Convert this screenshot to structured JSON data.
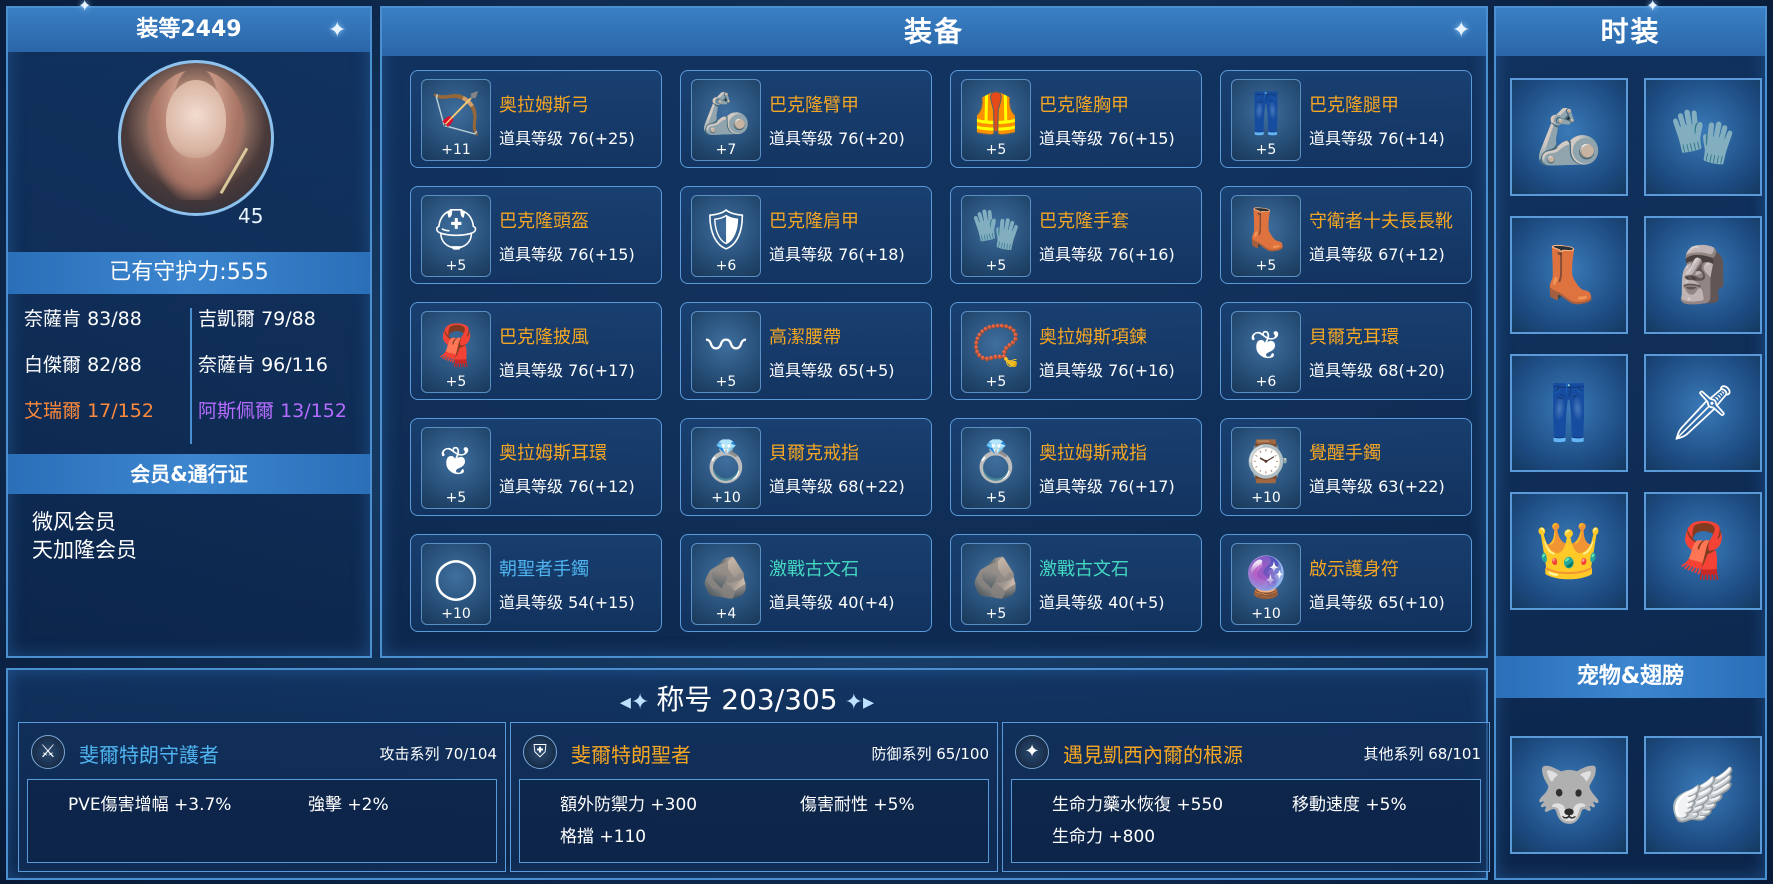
{
  "colors": {
    "panel_border": "#4a8fd0",
    "header_bg": "#3a7fc4",
    "orange_name": "#f5a623",
    "blue_name": "#4fb4f0",
    "teal_name": "#44d8c0",
    "stat_orange": "#ff8a3c",
    "stat_purple": "#b46cff",
    "title_orange": "#f5a623",
    "title_blue": "#4fb4f0"
  },
  "character": {
    "item_level_label": "装等2449",
    "level": "45",
    "guard_power": "已有守护力:555",
    "stats": [
      {
        "name": "奈薩肯",
        "value": "83/88",
        "color": "#ffffff"
      },
      {
        "name": "吉凱爾",
        "value": "79/88",
        "color": "#ffffff"
      },
      {
        "name": "白傑爾",
        "value": "82/88",
        "color": "#ffffff"
      },
      {
        "name": "奈薩肯",
        "value": "96/116",
        "color": "#ffffff"
      },
      {
        "name": "艾瑞爾",
        "value": "17/152",
        "color": "#ff8a3c"
      },
      {
        "name": "阿斯佩爾",
        "value": "13/152",
        "color": "#b46cff"
      }
    ],
    "vip_header": "会员&通行证",
    "vip_lines": [
      "微风会员",
      "天加隆会员"
    ]
  },
  "equipment": {
    "header": "装备",
    "items": [
      {
        "name": "奥拉姆斯弓",
        "level": "道具等级 76(+25)",
        "plus": "+11",
        "color": "#f5a623",
        "icon": "bow-icon",
        "glyph": "🏹"
      },
      {
        "name": "巴克隆臂甲",
        "level": "道具等级 76(+20)",
        "plus": "+7",
        "color": "#f5a623",
        "icon": "bracer-icon",
        "glyph": "🦾"
      },
      {
        "name": "巴克隆胸甲",
        "level": "道具等级 76(+15)",
        "plus": "+5",
        "color": "#f5a623",
        "icon": "chest-armor-icon",
        "glyph": "🦺"
      },
      {
        "name": "巴克隆腿甲",
        "level": "道具等级 76(+14)",
        "plus": "+5",
        "color": "#f5a623",
        "icon": "leg-armor-icon",
        "glyph": "👖"
      },
      {
        "name": "巴克隆頭盔",
        "level": "道具等级 76(+15)",
        "plus": "+5",
        "color": "#f5a623",
        "icon": "helmet-icon",
        "glyph": "⛑"
      },
      {
        "name": "巴克隆肩甲",
        "level": "道具等级 76(+18)",
        "plus": "+6",
        "color": "#f5a623",
        "icon": "shoulder-armor-icon",
        "glyph": "🛡"
      },
      {
        "name": "巴克隆手套",
        "level": "道具等级 76(+16)",
        "plus": "+5",
        "color": "#f5a623",
        "icon": "gloves-icon",
        "glyph": "🧤"
      },
      {
        "name": "守衛者十夫長長靴",
        "level": "道具等级 67(+12)",
        "plus": "+5",
        "color": "#f5a623",
        "icon": "boots-icon",
        "glyph": "👢"
      },
      {
        "name": "巴克隆披風",
        "level": "道具等级 76(+17)",
        "plus": "+5",
        "color": "#f5a623",
        "icon": "cape-icon",
        "glyph": "🧣"
      },
      {
        "name": "高潔腰帶",
        "level": "道具等级 65(+5)",
        "plus": "+5",
        "color": "#f5a623",
        "icon": "belt-icon",
        "glyph": "〰"
      },
      {
        "name": "奥拉姆斯項鍊",
        "level": "道具等级 76(+16)",
        "plus": "+5",
        "color": "#f5a623",
        "icon": "necklace-icon",
        "glyph": "📿"
      },
      {
        "name": "貝爾克耳環",
        "level": "道具等级 68(+20)",
        "plus": "+6",
        "color": "#f5a623",
        "icon": "earring-icon",
        "glyph": "❦"
      },
      {
        "name": "奥拉姆斯耳環",
        "level": "道具等级 76(+12)",
        "plus": "+5",
        "color": "#f5a623",
        "icon": "earring-icon",
        "glyph": "❦"
      },
      {
        "name": "貝爾克戒指",
        "level": "道具等级 68(+22)",
        "plus": "+10",
        "color": "#f5a623",
        "icon": "ring-icon",
        "glyph": "💍"
      },
      {
        "name": "奥拉姆斯戒指",
        "level": "道具等级 76(+17)",
        "plus": "+5",
        "color": "#f5a623",
        "icon": "ring-icon",
        "glyph": "💍"
      },
      {
        "name": "覺醒手鐲",
        "level": "道具等级 63(+22)",
        "plus": "+10",
        "color": "#f5a623",
        "icon": "bracelet-icon",
        "glyph": "⌚"
      },
      {
        "name": "朝聖者手鐲",
        "level": "道具等级 54(+15)",
        "plus": "+10",
        "color": "#4fb4f0",
        "icon": "bracelet-icon",
        "glyph": "◯"
      },
      {
        "name": "激戰古文石",
        "level": "道具等级 40(+4)",
        "plus": "+4",
        "color": "#44d8c0",
        "icon": "rune-stone-icon",
        "glyph": "🪨"
      },
      {
        "name": "激戰古文石",
        "level": "道具等级 40(+5)",
        "plus": "+5",
        "color": "#44d8c0",
        "icon": "rune-stone-icon",
        "glyph": "🪨"
      },
      {
        "name": "啟示護身符",
        "level": "道具等级 65(+10)",
        "plus": "+10",
        "color": "#f5a623",
        "icon": "amulet-icon",
        "glyph": "🔮"
      }
    ]
  },
  "costume": {
    "header": "时装",
    "slots": [
      {
        "icon": "costume-bracer-icon",
        "glyph": "🦾"
      },
      {
        "icon": "costume-glove-icon",
        "glyph": "🧤"
      },
      {
        "icon": "costume-boots-icon",
        "glyph": "👢"
      },
      {
        "icon": "costume-mask-icon",
        "glyph": "🗿"
      },
      {
        "icon": "costume-pants-icon",
        "glyph": "👖"
      },
      {
        "icon": "costume-weapon-icon",
        "glyph": "🗡"
      },
      {
        "icon": "costume-circlet-icon",
        "glyph": "👑"
      },
      {
        "icon": "costume-cape-icon",
        "glyph": "🧣"
      }
    ],
    "pet_header": "宠物&翅膀",
    "pet_slots": [
      {
        "icon": "pet-icon",
        "glyph": "🐺"
      },
      {
        "icon": "wings-icon",
        "glyph": "🪽"
      }
    ]
  },
  "titles": {
    "header": "称号 203/305",
    "cards": [
      {
        "name": "斐爾特朗守護者",
        "name_color": "#4fb4f0",
        "series": "攻击系列 70/104",
        "icon": "sword-emblem-icon",
        "glyph": "⚔",
        "bonuses": [
          "PVE傷害增幅 +3.7%",
          "強擊 +2%"
        ]
      },
      {
        "name": "斐爾特朗聖者",
        "name_color": "#f5a623",
        "series": "防御系列 65/100",
        "icon": "shield-emblem-icon",
        "glyph": "⛨",
        "bonuses": [
          "額外防禦力 +300",
          "傷害耐性 +5%",
          "格擋 +110"
        ]
      },
      {
        "name": "遇見凱西內爾的根源",
        "name_color": "#f5a623",
        "series": "其他系列 68/101",
        "icon": "star-emblem-icon",
        "glyph": "✦",
        "bonuses": [
          "生命力藥水恢復 +550",
          "移動速度 +5%",
          "生命力 +800"
        ]
      }
    ]
  }
}
